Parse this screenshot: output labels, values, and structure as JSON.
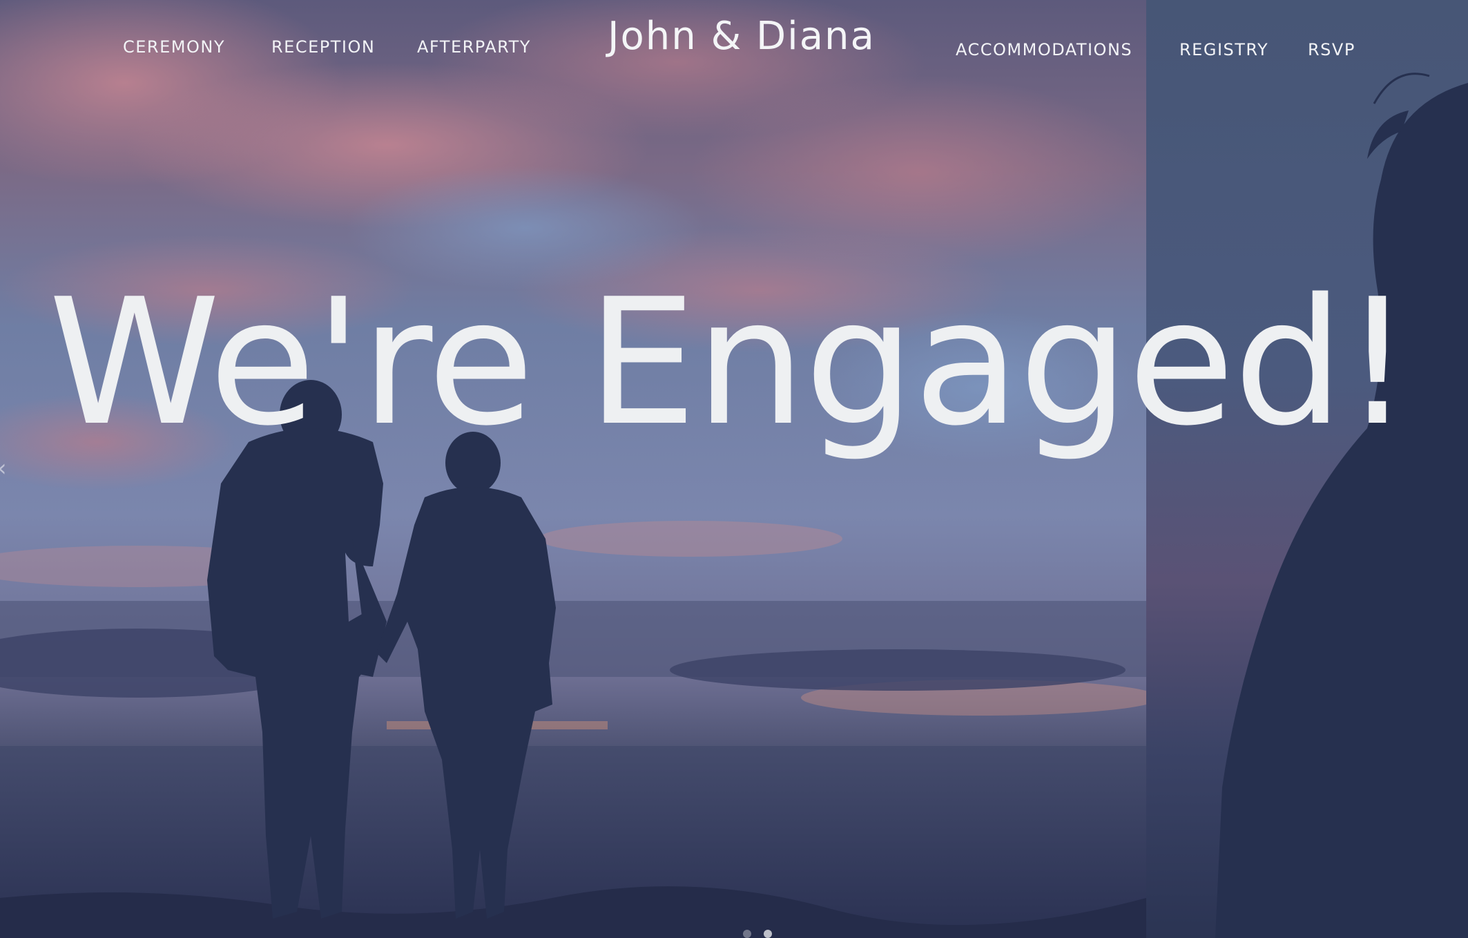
{
  "nav": {
    "left_links": [
      {
        "label": "CEREMONY"
      },
      {
        "label": "RECEPTION"
      },
      {
        "label": "AFTERPARTY"
      }
    ],
    "brand": "John & Diana",
    "right_links": [
      {
        "label": "ACCOMMODATIONS"
      },
      {
        "label": "REGISTRY"
      },
      {
        "label": "RSVP"
      }
    ]
  },
  "hero": {
    "title": "We're Engaged!"
  },
  "carousel": {
    "slide_count": 2,
    "active_slide": 1
  },
  "colors": {
    "overlay": "#27304e",
    "text": "#eef0f2",
    "sunset_pink": "#c98a9a",
    "sky_blue": "#6b7fa8"
  }
}
